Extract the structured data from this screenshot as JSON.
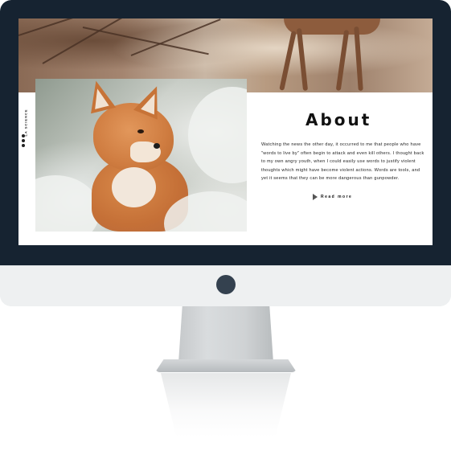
{
  "screen": {
    "side_brand": "LA SCIENCE",
    "about": {
      "title": "About",
      "body": "Watching the news the other day, it occurred to me that people who have \"words to live by\" often begin to attack and even kill others. I thought back to my own angry youth, when I could easily use words to justify violent thoughts which might have become violent actions. Words are tools, and yet it seems that they can be more dangerous than gunpowder.",
      "read_more_label": "Read more",
      "read_more_icon": "play-arrow-icon"
    },
    "photo_subject": "fox-image",
    "banner_subject": "deer-forest-banner"
  },
  "colors": {
    "bezel": "#162331",
    "chin": "#eef0f1",
    "camera_button": "#34414f",
    "text": "#111111"
  }
}
